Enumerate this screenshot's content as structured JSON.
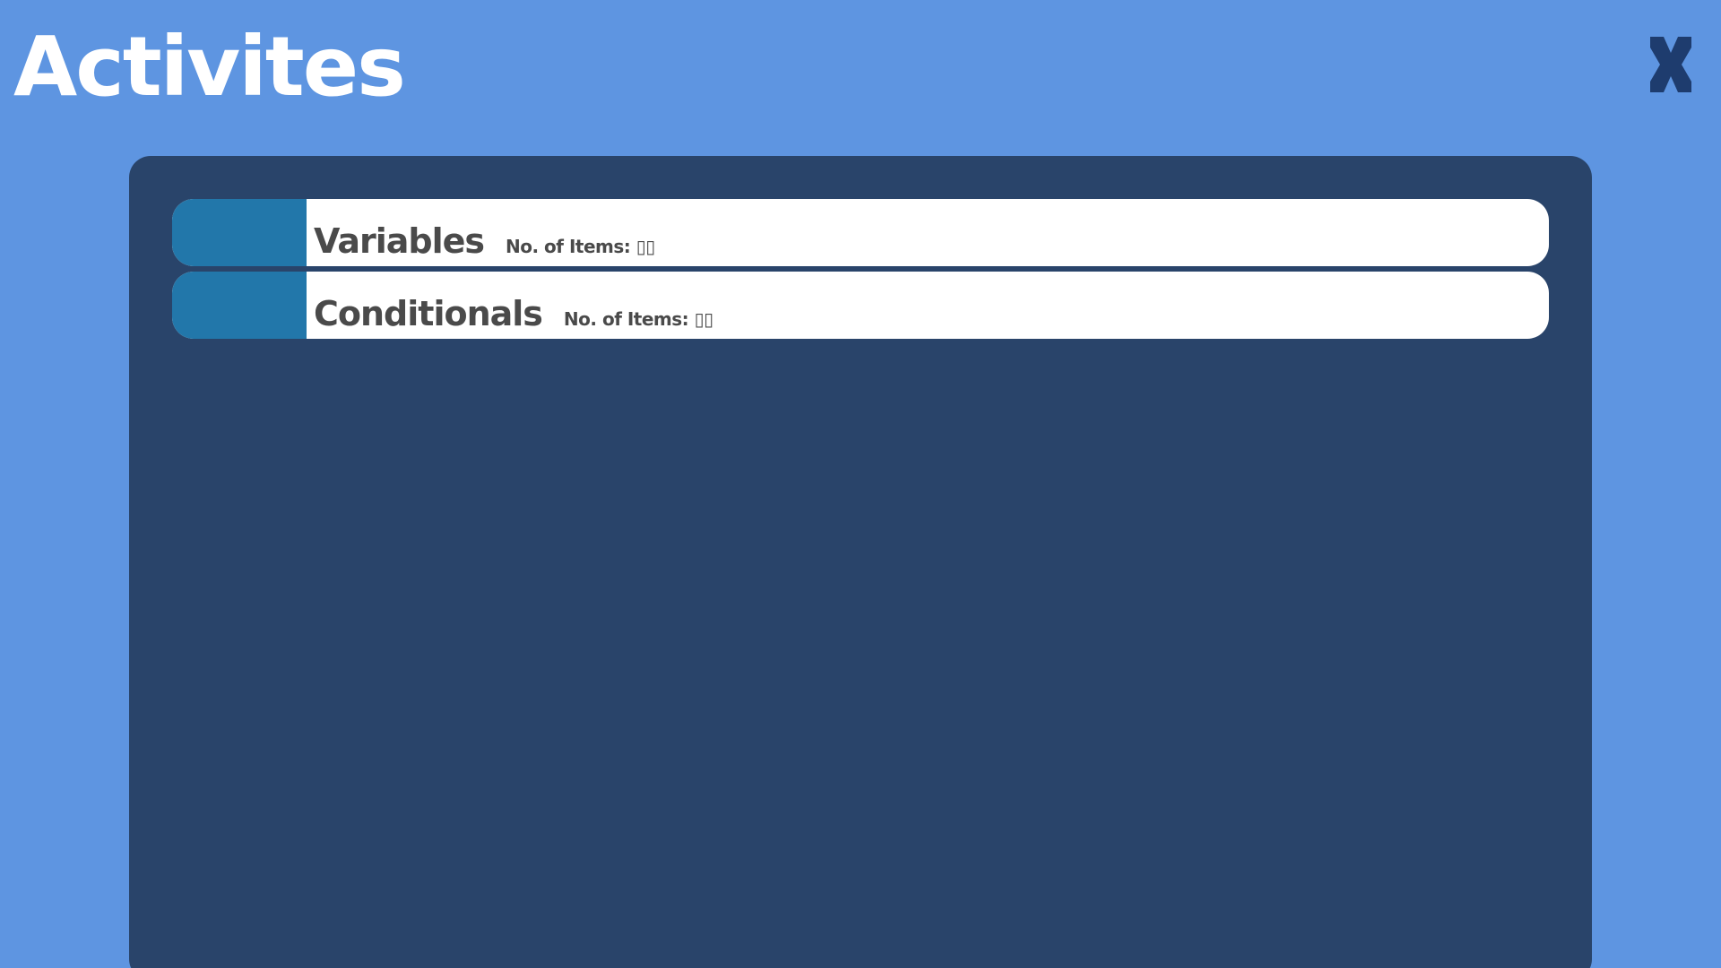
{
  "header": {
    "title": "Activites",
    "close_icon": "close-icon"
  },
  "activities": [
    {
      "name": "Variables",
      "count_label": "No. of Items: ▯▯"
    },
    {
      "name": "Conditionals",
      "count_label": "No. of Items: ▯▯"
    }
  ],
  "colors": {
    "background": "#5e95e1",
    "panel": "#29446a",
    "row_swatch": "#2277aa",
    "row_background": "#ffffff",
    "row_text": "#4a4a4a",
    "close_icon": "#1e3c6e",
    "title_text": "#ffffff"
  }
}
